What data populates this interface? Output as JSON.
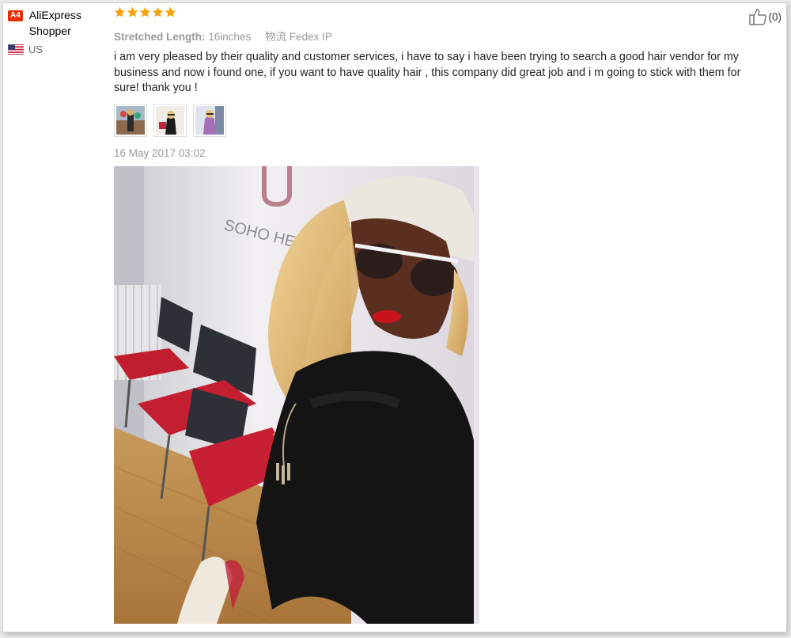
{
  "user": {
    "badge": "A4",
    "name": "AliExpress Shopper",
    "country": "US"
  },
  "review": {
    "rating": 5,
    "attributes": [
      {
        "label": "Stretched Length:",
        "value": "16inches"
      },
      {
        "label": "物流",
        "value": "Fedex IP"
      }
    ],
    "text": "i am very pleased by their quality and customer services, i have to say i have been trying to search a good hair vendor for my business and now i found one, if you want to have quality hair , this company did great job and i m going to stick with them for sure! thank you !",
    "date": "16 May 2017 03:02",
    "thumbnail_count": 3
  },
  "like": {
    "count": "(0)",
    "icon": "thumbs-up-icon"
  },
  "photo": {
    "sign_text": "SOHO HEALTH"
  },
  "colors": {
    "badge": "#e62e04",
    "star": "#f8a20a",
    "meta_text": "#9a9a9a"
  }
}
